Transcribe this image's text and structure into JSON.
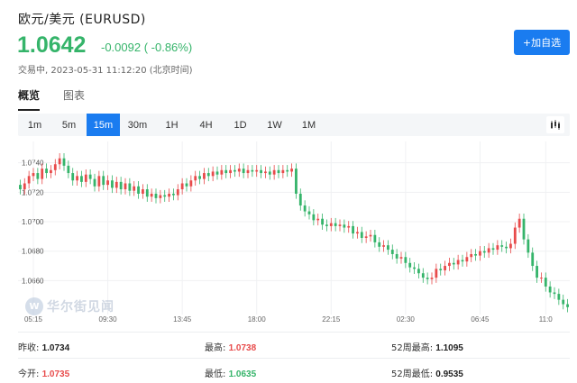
{
  "header": {
    "title": "欧元/美元 (EURUSD)",
    "price": "1.0642",
    "change": "-0.0092 ( -0.86%)",
    "status": "交易中, 2023-05-31 11:12:20 (北京时间)",
    "add_button": "+加自选"
  },
  "tabs": [
    {
      "label": "概览",
      "active": true
    },
    {
      "label": "图表",
      "active": false
    }
  ],
  "periods": [
    {
      "label": "1m",
      "active": false
    },
    {
      "label": "5m",
      "active": false
    },
    {
      "label": "15m",
      "active": true
    },
    {
      "label": "30m",
      "active": false
    },
    {
      "label": "1H",
      "active": false
    },
    {
      "label": "4H",
      "active": false
    },
    {
      "label": "1D",
      "active": false
    },
    {
      "label": "1W",
      "active": false
    },
    {
      "label": "1M",
      "active": false
    }
  ],
  "chart_type_icon": "candlestick-chart-icon",
  "watermark": "华尔街见闻",
  "chart_data": {
    "type": "candlestick",
    "y_ticks": [
      "1.0740",
      "1.0720",
      "1.0700",
      "1.0680",
      "1.0660"
    ],
    "y_tick_values": [
      1.074,
      1.072,
      1.07,
      1.068,
      1.066
    ],
    "ylim": [
      1.0637,
      1.0752
    ],
    "x_ticks": [
      "05:15",
      "09:30",
      "13:45",
      "18:00",
      "22:15",
      "02:30",
      "06:45",
      "11:0"
    ],
    "x_tick_index": [
      3,
      20,
      37,
      54,
      71,
      88,
      105,
      120
    ],
    "colors": {
      "up": "#e84b4b",
      "down": "#35b46a"
    },
    "closes": [
      1.0722,
      1.0726,
      1.0731,
      1.0733,
      1.0729,
      1.0736,
      1.0733,
      1.0735,
      1.0739,
      1.0743,
      1.0738,
      1.0733,
      1.0728,
      1.0731,
      1.0727,
      1.0732,
      1.0729,
      1.0724,
      1.0731,
      1.0725,
      1.0728,
      1.0723,
      1.0727,
      1.0722,
      1.0726,
      1.0721,
      1.0724,
      1.0719,
      1.0722,
      1.0717,
      1.0719,
      1.0716,
      1.0718,
      1.0717,
      1.0719,
      1.0718,
      1.0722,
      1.0726,
      1.0724,
      1.0728,
      1.0731,
      1.0729,
      1.0733,
      1.0731,
      1.0734,
      1.0732,
      1.0735,
      1.0733,
      1.0735,
      1.0734,
      1.0736,
      1.0733,
      1.0735,
      1.0734,
      1.0735,
      1.0733,
      1.0734,
      1.0732,
      1.0735,
      1.0733,
      1.0735,
      1.0734,
      1.0736,
      1.0719,
      1.0711,
      1.0707,
      1.0705,
      1.0701,
      1.0702,
      1.0698,
      1.0697,
      1.0699,
      1.0697,
      1.0698,
      1.0696,
      1.0697,
      1.0692,
      1.0693,
      1.0689,
      1.069,
      1.0691,
      1.0686,
      1.0683,
      1.0684,
      1.0681,
      1.0678,
      1.0675,
      1.0676,
      1.0672,
      1.0669,
      1.0668,
      1.0665,
      1.0662,
      1.0661,
      1.0662,
      1.0668,
      1.0667,
      1.067,
      1.0672,
      1.0671,
      1.0674,
      1.0673,
      1.0676,
      1.0678,
      1.0677,
      1.068,
      1.0679,
      1.0682,
      1.0681,
      1.0684,
      1.0683,
      1.0682,
      1.0685,
      1.0696,
      1.0702,
      1.0688,
      1.0679,
      1.067,
      1.0662,
      1.0662,
      1.0656,
      1.0652,
      1.0651,
      1.0647,
      1.0644,
      1.0642
    ]
  },
  "stats": [
    {
      "label": "昨收:",
      "value": "1.0734",
      "tone": "neutral"
    },
    {
      "label": "最高:",
      "value": "1.0738",
      "tone": "up"
    },
    {
      "label": "52周最高:",
      "value": "1.1095",
      "tone": "neutral"
    },
    {
      "label": "今开:",
      "value": "1.0735",
      "tone": "up"
    },
    {
      "label": "最低:",
      "value": "1.0635",
      "tone": "down"
    },
    {
      "label": "52周最低:",
      "value": "0.9535",
      "tone": "neutral"
    }
  ]
}
